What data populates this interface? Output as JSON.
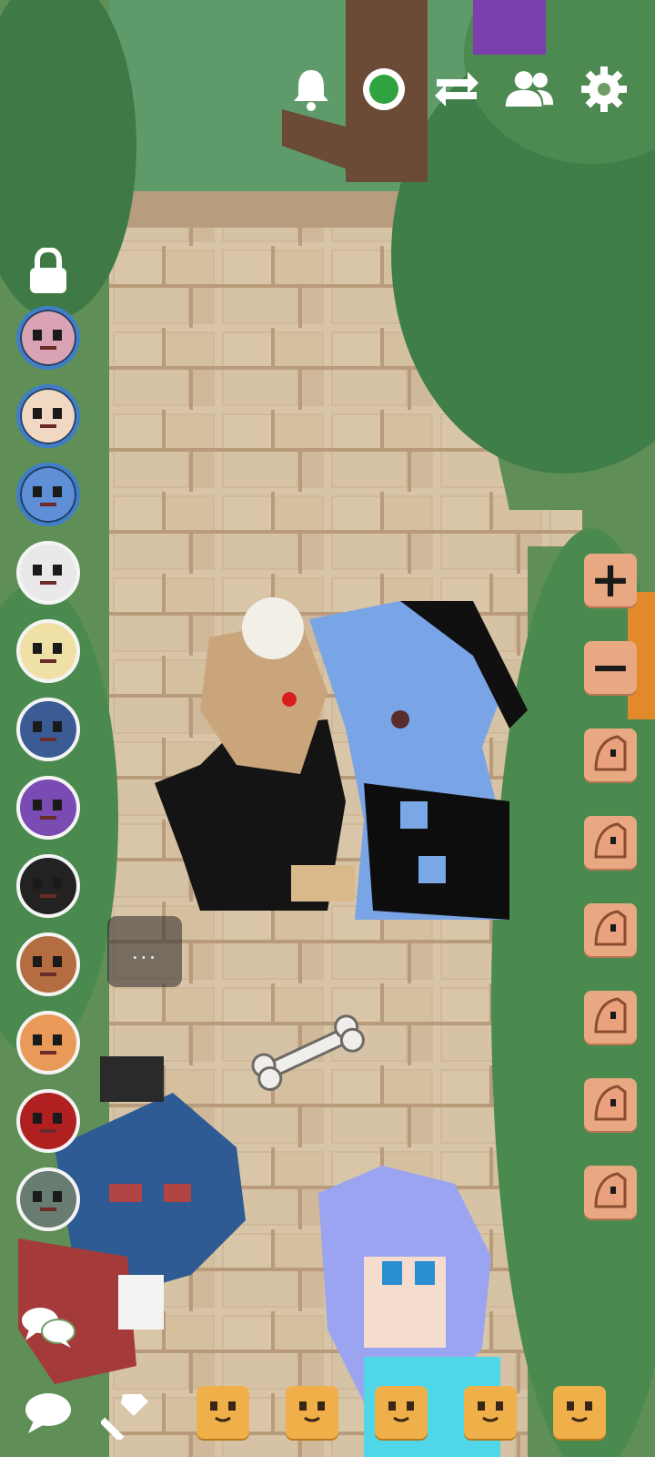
{
  "top_bar": {
    "icons": [
      "bell-icon",
      "online-status-icon",
      "swap-icon",
      "friends-icon",
      "gear-icon"
    ],
    "status_color": "#2fa33f"
  },
  "lock": {
    "icon": "lock-icon"
  },
  "player_list": {
    "avatars": [
      {
        "name": "avatar-pink-hair",
        "color": "#d9a3b3",
        "state": "online"
      },
      {
        "name": "avatar-cream-pony",
        "color": "#f0d8c2",
        "state": "online"
      },
      {
        "name": "avatar-blue-pony",
        "color": "#5f8fd6",
        "state": "online"
      },
      {
        "name": "avatar-white-pony",
        "color": "#e9e9e9",
        "state": "offline"
      },
      {
        "name": "avatar-blonde-pony",
        "color": "#efe1a6",
        "state": "offline"
      },
      {
        "name": "avatar-dark-blue-pony",
        "color": "#3b5b95",
        "state": "offline"
      },
      {
        "name": "avatar-purple-pony",
        "color": "#7a4bb2",
        "state": "offline"
      },
      {
        "name": "avatar-black-pony",
        "color": "#222222",
        "state": "offline"
      },
      {
        "name": "avatar-brown-hair-pony",
        "color": "#b46d41",
        "state": "offline"
      },
      {
        "name": "avatar-orange-pony",
        "color": "#e99a59",
        "state": "offline"
      },
      {
        "name": "avatar-red-pony",
        "color": "#b02020",
        "state": "offline"
      },
      {
        "name": "avatar-gray-pony",
        "color": "#687c72",
        "state": "offline"
      }
    ]
  },
  "side_actions": [
    {
      "name": "zoom-in-button",
      "glyph": "+"
    },
    {
      "name": "zoom-out-button",
      "glyph": "−"
    },
    {
      "name": "expression-button-1",
      "glyph": ""
    },
    {
      "name": "expression-button-2",
      "glyph": ""
    },
    {
      "name": "expression-button-3",
      "glyph": ""
    },
    {
      "name": "expression-button-4",
      "glyph": ""
    },
    {
      "name": "expression-button-5",
      "glyph": ""
    },
    {
      "name": "expression-button-6",
      "glyph": ""
    }
  ],
  "bottom_actions": [
    {
      "name": "emote-button-1"
    },
    {
      "name": "emote-button-2"
    },
    {
      "name": "emote-button-3"
    },
    {
      "name": "emote-button-4"
    },
    {
      "name": "emote-button-5"
    }
  ],
  "bottom_left": {
    "chat_log_icon": "chat-log-icon",
    "chat_icon": "chat-icon",
    "build_icon": "hammer-icon"
  },
  "typing_indicator": "..."
}
